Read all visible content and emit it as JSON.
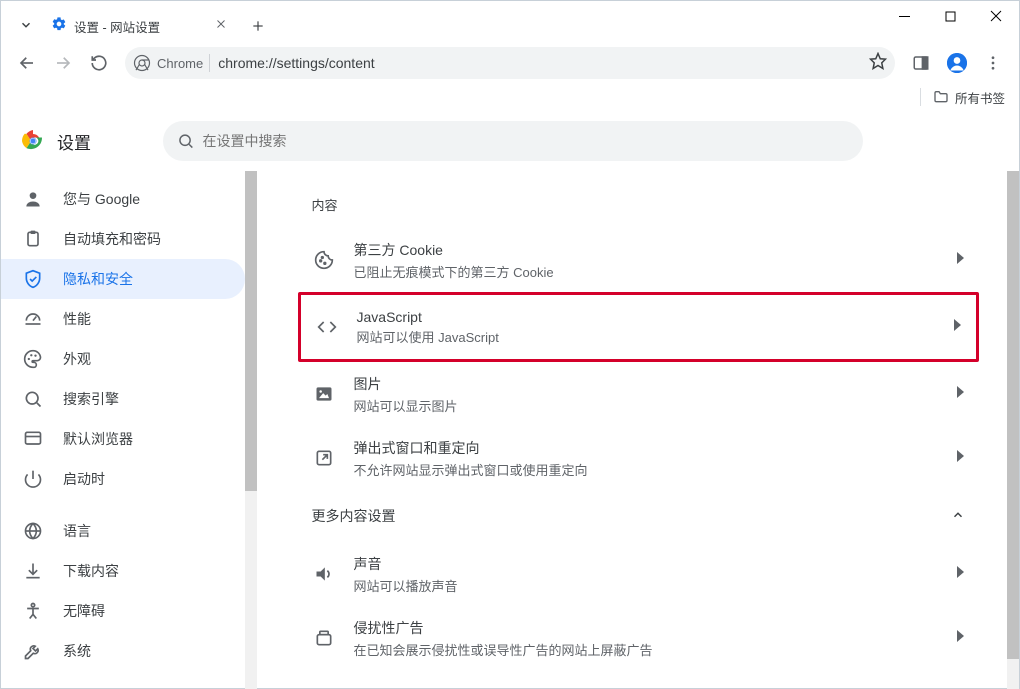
{
  "tab": {
    "title": "设置 - 网站设置"
  },
  "omnibox": {
    "chip": "Chrome",
    "url": "chrome://settings/content"
  },
  "bookmarks_bar": {
    "all_bookmarks": "所有书签"
  },
  "settings_header": {
    "title": "设置",
    "search_placeholder": "在设置中搜索"
  },
  "sidebar": {
    "items": [
      {
        "label": "您与 Google"
      },
      {
        "label": "自动填充和密码"
      },
      {
        "label": "隐私和安全"
      },
      {
        "label": "性能"
      },
      {
        "label": "外观"
      },
      {
        "label": "搜索引擎"
      },
      {
        "label": "默认浏览器"
      },
      {
        "label": "启动时"
      },
      {
        "label": "语言"
      },
      {
        "label": "下载内容"
      },
      {
        "label": "无障碍"
      },
      {
        "label": "系统"
      }
    ]
  },
  "content": {
    "heading": "内容",
    "rows": [
      {
        "title": "第三方 Cookie",
        "sub": "已阻止无痕模式下的第三方 Cookie"
      },
      {
        "title": "JavaScript",
        "sub": "网站可以使用 JavaScript"
      },
      {
        "title": "图片",
        "sub": "网站可以显示图片"
      },
      {
        "title": "弹出式窗口和重定向",
        "sub": "不允许网站显示弹出式窗口或使用重定向"
      }
    ],
    "more_heading": "更多内容设置",
    "more_rows": [
      {
        "title": "声音",
        "sub": "网站可以播放声音"
      },
      {
        "title": "侵扰性广告",
        "sub": "在已知会展示侵扰性或误导性广告的网站上屏蔽广告"
      }
    ]
  }
}
